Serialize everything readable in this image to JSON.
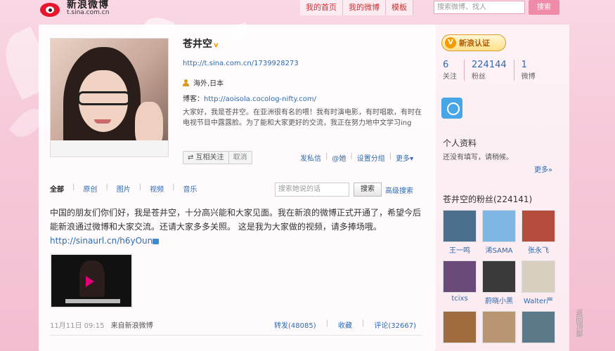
{
  "brand": {
    "name": "新浪微博",
    "domain": "t.sina.com.cn"
  },
  "nav": [
    "我的首页",
    "我的微博",
    "模板"
  ],
  "top_search": {
    "placeholder": "搜索微博、找人",
    "button": "搜索"
  },
  "profile": {
    "name": "苍井空",
    "verified_mark": "v",
    "url": "http://t.sina.com.cn/1739928273",
    "location": "海外,日本",
    "blog_label": "博客：",
    "blog_url": "http://aoisola.cocolog-nifty.com/",
    "bio": "大家好，我是苍井空。在亚洲很有名的喂！我有时演电影，有时唱歌，有时在电视节目中露露脸。为了能和大家更好的交流，我正在努力地中文学习ing",
    "follow_label": "⇄ 互相关注",
    "cancel_label": "取消",
    "actions": [
      "发私信",
      "@她",
      "设置分组",
      "更多▾"
    ]
  },
  "tabs": [
    "全部",
    "原创",
    "图片",
    "视频",
    "音乐"
  ],
  "her_search": {
    "placeholder": "搜索她说的话",
    "button": "搜索",
    "advanced": "高级搜索"
  },
  "post": {
    "text": "中国的朋友们你们好，我是苍井空，十分高兴能和大家见面。我在新浪的微博正式开通了，希望今后能新浪通过微博和大家交流。还请大家多多关照。 这是我为大家做的视频，请多捧场哦。",
    "link": "http://sinaurl.cn/h6yOun",
    "date": "11月11日 09:15",
    "source": "来自新浪微博",
    "repost": "转发(48085)",
    "favorite": "收藏",
    "comment": "评论(32667)"
  },
  "sidebar": {
    "badge": "新浪认证",
    "stats": [
      {
        "num": "6",
        "label": "关注"
      },
      {
        "num": "224144",
        "label": "粉丝"
      },
      {
        "num": "1",
        "label": "微博"
      }
    ],
    "info_title": "个人资料",
    "info_sub": "还没有填写，请稍候。",
    "more": "更多»",
    "fans_title": "苍井空的粉丝(224141)",
    "fans": [
      {
        "name": "王一鸣",
        "color": "#4b6f8c"
      },
      {
        "name": "浠SAMA",
        "color": "#7fb6e3"
      },
      {
        "name": "张永飞",
        "color": "#b54b3c"
      },
      {
        "name": "tcixs",
        "color": "#6b4a7a"
      },
      {
        "name": "蔚晓小黑",
        "color": "#3a3a3a"
      },
      {
        "name": "Walter严",
        "color": "#d9cfc0"
      },
      {
        "name": "",
        "color": "#a06b3e"
      },
      {
        "name": "",
        "color": "#b89672"
      },
      {
        "name": "",
        "color": "#5a7a8a"
      }
    ]
  },
  "return_top": "返回顶部"
}
